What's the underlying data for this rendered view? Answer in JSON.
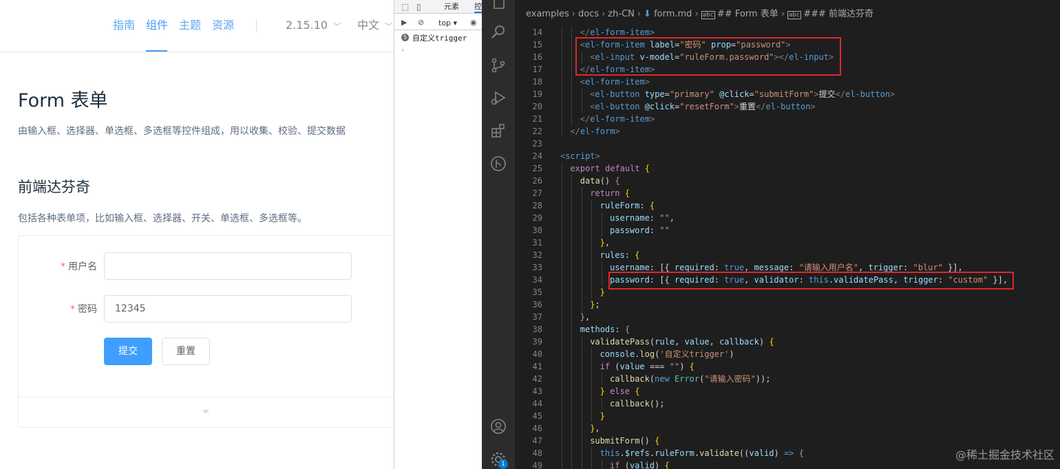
{
  "docs": {
    "nav": {
      "items": [
        {
          "label": "指南"
        },
        {
          "label": "组件"
        },
        {
          "label": "主题"
        },
        {
          "label": "资源"
        }
      ],
      "version": "2.15.10",
      "language": "中文"
    },
    "title": "Form 表单",
    "description": "由输入框、选择器、单选框、多选框等控件组成，用以收集、校验、提交数据",
    "section_title": "前端达芬奇",
    "section_description": "包括各种表单项，比如输入框、选择器、开关、单选框、多选框等。",
    "form": {
      "username_label": "用户名",
      "username_value": "",
      "password_label": "密码",
      "password_value": "12345",
      "submit_label": "提交",
      "reset_label": "重置",
      "required_mark": "*"
    }
  },
  "devtools": {
    "tabs": [
      {
        "label": "元素"
      },
      {
        "label": "控"
      }
    ],
    "context": "top",
    "log_count": "5",
    "log_message": "自定义trigger",
    "prompt": "›"
  },
  "editor": {
    "breadcrumb": {
      "parts": [
        "examples",
        "docs",
        "zh-CN",
        "form.md"
      ],
      "heading1": "## Form 表单",
      "heading2": "### 前端达芬奇"
    },
    "notification_badge": "1",
    "watermark": "@稀土掘金技术社区",
    "lines": [
      {
        "n": "14",
        "indent": 2,
        "tokens": [
          [
            "bracket",
            "</"
          ],
          [
            "tag",
            "el-form-item"
          ],
          [
            "bracket",
            ">"
          ]
        ]
      },
      {
        "n": "15",
        "indent": 2,
        "tokens": [
          [
            "bracket",
            "<"
          ],
          [
            "tag",
            "el-form-item"
          ],
          [
            "text",
            " "
          ],
          [
            "attr",
            "label"
          ],
          [
            "text",
            "="
          ],
          [
            "str",
            "\"密码\""
          ],
          [
            "text",
            " "
          ],
          [
            "attr",
            "prop"
          ],
          [
            "text",
            "="
          ],
          [
            "str",
            "\"password\""
          ],
          [
            "bracket",
            ">"
          ]
        ]
      },
      {
        "n": "16",
        "indent": 3,
        "tokens": [
          [
            "bracket",
            "<"
          ],
          [
            "tag",
            "el-input"
          ],
          [
            "text",
            " "
          ],
          [
            "attr",
            "v-model"
          ],
          [
            "text",
            "="
          ],
          [
            "str",
            "\"ruleForm.password\""
          ],
          [
            "bracket",
            "></"
          ],
          [
            "tag",
            "el-input"
          ],
          [
            "bracket",
            ">"
          ]
        ]
      },
      {
        "n": "17",
        "indent": 2,
        "tokens": [
          [
            "bracket",
            "</"
          ],
          [
            "tag",
            "el-form-item"
          ],
          [
            "bracket",
            ">"
          ]
        ]
      },
      {
        "n": "18",
        "indent": 2,
        "tokens": [
          [
            "bracket",
            "<"
          ],
          [
            "tag",
            "el-form-item"
          ],
          [
            "bracket",
            ">"
          ]
        ]
      },
      {
        "n": "19",
        "indent": 3,
        "tokens": [
          [
            "bracket",
            "<"
          ],
          [
            "tag",
            "el-button"
          ],
          [
            "text",
            " "
          ],
          [
            "attr",
            "type"
          ],
          [
            "text",
            "="
          ],
          [
            "str",
            "\"primary\""
          ],
          [
            "text",
            " "
          ],
          [
            "attr",
            "@click"
          ],
          [
            "text",
            "="
          ],
          [
            "str",
            "\"submitForm\""
          ],
          [
            "bracket",
            ">"
          ],
          [
            "text",
            "提交"
          ],
          [
            "bracket",
            "</"
          ],
          [
            "tag",
            "el-button"
          ],
          [
            "bracket",
            ">"
          ]
        ]
      },
      {
        "n": "20",
        "indent": 3,
        "tokens": [
          [
            "bracket",
            "<"
          ],
          [
            "tag",
            "el-button"
          ],
          [
            "text",
            " "
          ],
          [
            "attr",
            "@click"
          ],
          [
            "text",
            "="
          ],
          [
            "str",
            "\"resetForm\""
          ],
          [
            "bracket",
            ">"
          ],
          [
            "text",
            "重置"
          ],
          [
            "bracket",
            "</"
          ],
          [
            "tag",
            "el-button"
          ],
          [
            "bracket",
            ">"
          ]
        ]
      },
      {
        "n": "21",
        "indent": 2,
        "tokens": [
          [
            "bracket",
            "</"
          ],
          [
            "tag",
            "el-form-item"
          ],
          [
            "bracket",
            ">"
          ]
        ]
      },
      {
        "n": "22",
        "indent": 1,
        "tokens": [
          [
            "bracket",
            "</"
          ],
          [
            "tag",
            "el-form"
          ],
          [
            "bracket",
            ">"
          ]
        ]
      },
      {
        "n": "23",
        "indent": 0,
        "tokens": []
      },
      {
        "n": "24",
        "indent": 0,
        "tokens": [
          [
            "bracket",
            "<"
          ],
          [
            "tag",
            "script"
          ],
          [
            "bracket",
            ">"
          ]
        ]
      },
      {
        "n": "25",
        "indent": 1,
        "tokens": [
          [
            "kw",
            "export"
          ],
          [
            "text",
            " "
          ],
          [
            "kw",
            "default"
          ],
          [
            "text",
            " "
          ],
          [
            "yellow",
            "{"
          ]
        ]
      },
      {
        "n": "26",
        "indent": 2,
        "tokens": [
          [
            "fn",
            "data"
          ],
          [
            "text",
            "() "
          ],
          [
            "kw2",
            "{"
          ]
        ]
      },
      {
        "n": "27",
        "indent": 3,
        "tokens": [
          [
            "kw",
            "return"
          ],
          [
            "text",
            " "
          ],
          [
            "yellow",
            "{"
          ]
        ]
      },
      {
        "n": "28",
        "indent": 4,
        "tokens": [
          [
            "prop",
            "ruleForm"
          ],
          [
            "text",
            ": "
          ],
          [
            "yellow",
            "{"
          ]
        ]
      },
      {
        "n": "29",
        "indent": 5,
        "tokens": [
          [
            "prop",
            "username"
          ],
          [
            "text",
            ": "
          ],
          [
            "str",
            "\"\""
          ],
          [
            "text",
            ","
          ]
        ]
      },
      {
        "n": "30",
        "indent": 5,
        "tokens": [
          [
            "prop",
            "password"
          ],
          [
            "text",
            ": "
          ],
          [
            "str",
            "\"\""
          ]
        ]
      },
      {
        "n": "31",
        "indent": 4,
        "tokens": [
          [
            "yellow",
            "}"
          ],
          [
            "text",
            ","
          ]
        ]
      },
      {
        "n": "32",
        "indent": 4,
        "tokens": [
          [
            "prop",
            "rules"
          ],
          [
            "text",
            ": "
          ],
          [
            "yellow",
            "{"
          ]
        ]
      },
      {
        "n": "33",
        "indent": 5,
        "tokens": [
          [
            "prop",
            "username"
          ],
          [
            "text",
            ": [{ "
          ],
          [
            "prop",
            "required"
          ],
          [
            "text",
            ": "
          ],
          [
            "bool",
            "true"
          ],
          [
            "text",
            ", "
          ],
          [
            "prop",
            "message"
          ],
          [
            "text",
            ": "
          ],
          [
            "str",
            "\"请输入用户名\""
          ],
          [
            "text",
            ", "
          ],
          [
            "prop",
            "trigger"
          ],
          [
            "text",
            ": "
          ],
          [
            "str",
            "\"blur\""
          ],
          [
            "text",
            " }],"
          ]
        ]
      },
      {
        "n": "34",
        "indent": 5,
        "tokens": [
          [
            "prop",
            "password"
          ],
          [
            "text",
            ": [{ "
          ],
          [
            "prop",
            "required"
          ],
          [
            "text",
            ": "
          ],
          [
            "bool",
            "true"
          ],
          [
            "text",
            ", "
          ],
          [
            "prop",
            "validator"
          ],
          [
            "text",
            ": "
          ],
          [
            "bool",
            "this"
          ],
          [
            "text",
            "."
          ],
          [
            "prop",
            "validatePass"
          ],
          [
            "text",
            ", "
          ],
          [
            "prop",
            "trigger"
          ],
          [
            "text",
            ": "
          ],
          [
            "str",
            "\"custom\""
          ],
          [
            "text",
            " }],"
          ]
        ]
      },
      {
        "n": "35",
        "indent": 4,
        "tokens": [
          [
            "yellow",
            "}"
          ]
        ]
      },
      {
        "n": "36",
        "indent": 3,
        "tokens": [
          [
            "yellow",
            "}"
          ],
          [
            "text",
            ";"
          ]
        ]
      },
      {
        "n": "37",
        "indent": 2,
        "tokens": [
          [
            "kw2",
            "}"
          ],
          [
            "text",
            ","
          ]
        ]
      },
      {
        "n": "38",
        "indent": 2,
        "tokens": [
          [
            "prop",
            "methods"
          ],
          [
            "text",
            ": "
          ],
          [
            "kw2",
            "{"
          ]
        ]
      },
      {
        "n": "39",
        "indent": 3,
        "tokens": [
          [
            "fn",
            "validatePass"
          ],
          [
            "text",
            "("
          ],
          [
            "prop",
            "rule"
          ],
          [
            "text",
            ", "
          ],
          [
            "prop",
            "value"
          ],
          [
            "text",
            ", "
          ],
          [
            "prop",
            "callback"
          ],
          [
            "text",
            ") "
          ],
          [
            "yellow",
            "{"
          ]
        ]
      },
      {
        "n": "40",
        "indent": 4,
        "tokens": [
          [
            "prop",
            "console"
          ],
          [
            "text",
            "."
          ],
          [
            "fn",
            "log"
          ],
          [
            "text",
            "("
          ],
          [
            "str",
            "'自定义trigger'"
          ],
          [
            "text",
            ")"
          ]
        ]
      },
      {
        "n": "41",
        "indent": 4,
        "tokens": [
          [
            "kw",
            "if"
          ],
          [
            "text",
            " ("
          ],
          [
            "prop",
            "value"
          ],
          [
            "text",
            " === "
          ],
          [
            "str",
            "\"\""
          ],
          [
            "text",
            ") "
          ],
          [
            "yellow",
            "{"
          ]
        ]
      },
      {
        "n": "42",
        "indent": 5,
        "tokens": [
          [
            "fn",
            "callback"
          ],
          [
            "text",
            "("
          ],
          [
            "bool",
            "new"
          ],
          [
            "text",
            " "
          ],
          [
            "cls",
            "Error"
          ],
          [
            "text",
            "("
          ],
          [
            "str",
            "\"请输入密码\""
          ],
          [
            "text",
            "));"
          ]
        ]
      },
      {
        "n": "43",
        "indent": 4,
        "tokens": [
          [
            "yellow",
            "}"
          ],
          [
            "text",
            " "
          ],
          [
            "kw",
            "else"
          ],
          [
            "text",
            " "
          ],
          [
            "yellow",
            "{"
          ]
        ]
      },
      {
        "n": "44",
        "indent": 5,
        "tokens": [
          [
            "fn",
            "callback"
          ],
          [
            "text",
            "();"
          ]
        ]
      },
      {
        "n": "45",
        "indent": 4,
        "tokens": [
          [
            "yellow",
            "}"
          ]
        ]
      },
      {
        "n": "46",
        "indent": 3,
        "tokens": [
          [
            "yellow",
            "}"
          ],
          [
            "text",
            ","
          ]
        ]
      },
      {
        "n": "47",
        "indent": 3,
        "tokens": [
          [
            "fn",
            "submitForm"
          ],
          [
            "text",
            "() "
          ],
          [
            "yellow",
            "{"
          ]
        ]
      },
      {
        "n": "48",
        "indent": 4,
        "tokens": [
          [
            "bool",
            "this"
          ],
          [
            "text",
            "."
          ],
          [
            "prop",
            "$refs"
          ],
          [
            "text",
            "."
          ],
          [
            "prop",
            "ruleForm"
          ],
          [
            "text",
            "."
          ],
          [
            "fn",
            "validate"
          ],
          [
            "text",
            "(("
          ],
          [
            "prop",
            "valid"
          ],
          [
            "text",
            ") "
          ],
          [
            "bool",
            "=>"
          ],
          [
            "text",
            " "
          ],
          [
            "kw2",
            "{"
          ]
        ]
      },
      {
        "n": "49",
        "indent": 5,
        "tokens": [
          [
            "kw",
            "if"
          ],
          [
            "text",
            " ("
          ],
          [
            "prop",
            "valid"
          ],
          [
            "text",
            ") "
          ],
          [
            "yellow",
            "{"
          ]
        ]
      }
    ]
  }
}
